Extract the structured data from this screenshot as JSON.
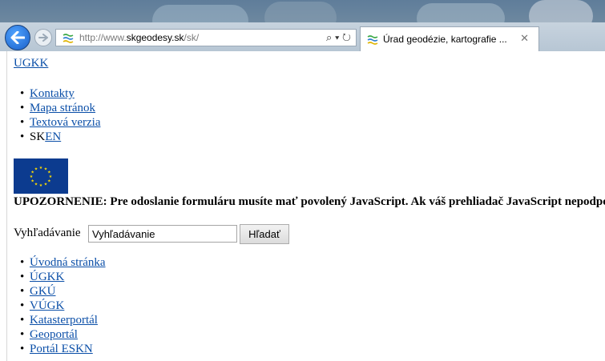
{
  "browser": {
    "url_prefix": "http://www.",
    "url_domain": "skgeodesy.sk",
    "url_path": "/sk/",
    "search_glyph": "⌕ ▾",
    "refresh_glyph": "↻",
    "tab_title": "Úrad geodézie, kartografie ...",
    "tab_close": "✕",
    "icons": {
      "back": "back-arrow-icon",
      "forward": "forward-arrow-icon",
      "favicon": "site-favicon-icon"
    }
  },
  "page": {
    "brand_link": "UGKK",
    "top_links": [
      "Kontakty",
      "Mapa stránok",
      "Textová verzia"
    ],
    "lang_current": "SK",
    "lang_other": "EN",
    "warning": "UPOZORNENIE: Pre odoslanie formuláru musíte mať povolený JavaScript. Ak váš prehliadač JavaScript nepodporuje",
    "search": {
      "label": "Vyhľadávanie",
      "value": "Vyhľadávanie",
      "button": "Hľadať"
    },
    "main_links": [
      "Úvodná stránka",
      "ÚGKK",
      "GKÚ",
      "VÚGK",
      "Katasterportál",
      "Geoportál",
      "Portál ESKN"
    ]
  },
  "colors": {
    "link": "#0b4fa8",
    "eu_flag": "#0c3b8f",
    "eu_stars": "#ffdd00"
  }
}
